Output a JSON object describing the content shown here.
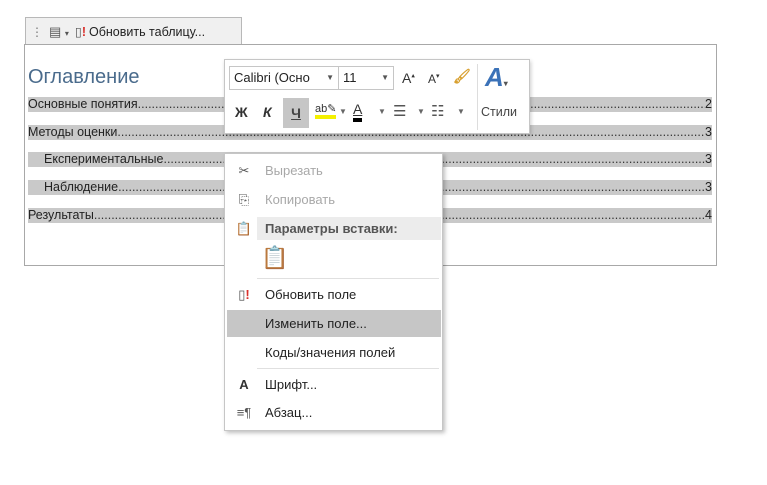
{
  "field_tab": {
    "update_table_label": "Обновить таблицу..."
  },
  "document": {
    "title": "Оглавление",
    "toc": [
      {
        "text": "Основные понятия",
        "page": "2",
        "level": 1
      },
      {
        "text": "Методы оценки",
        "page": "3",
        "level": 1
      },
      {
        "text": "Експериментальные",
        "page": "3",
        "level": 2
      },
      {
        "text": "Наблюдение",
        "page": "3",
        "level": 2
      },
      {
        "text": "Результаты",
        "page": "4",
        "level": 1
      }
    ]
  },
  "mini_toolbar": {
    "font_name": "Calibri (Осно",
    "font_size": "11",
    "bold": "Ж",
    "italic": "К",
    "underline": "Ч",
    "styles_label": "Стили"
  },
  "context_menu": {
    "cut": "Вырезать",
    "copy": "Копировать",
    "paste_options": "Параметры вставки:",
    "update_field": "Обновить поле",
    "edit_field": "Изменить поле...",
    "toggle_codes": "Коды/значения полей",
    "font": "Шрифт...",
    "paragraph": "Абзац..."
  }
}
